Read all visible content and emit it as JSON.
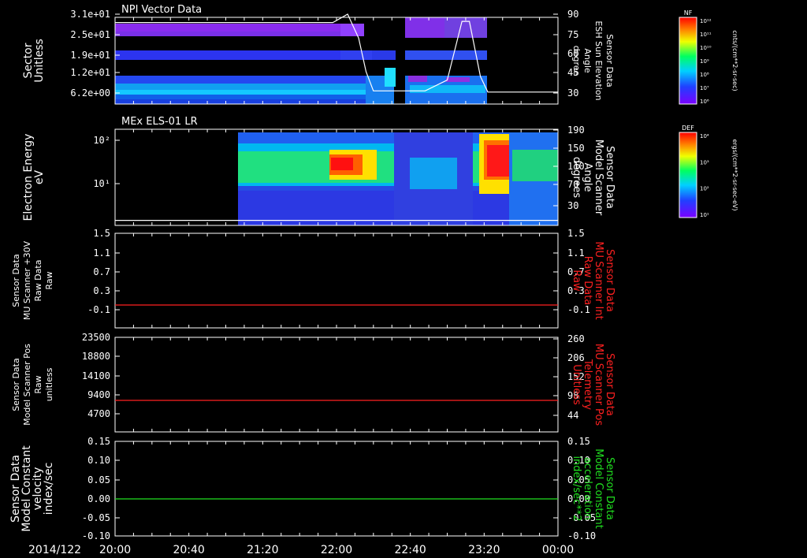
{
  "chart_data": {
    "type": "heatmap",
    "date_label": "2014/122",
    "x_axis": {
      "unit": "time",
      "start": "20:00",
      "end": "00:00",
      "ticks": [
        "20:00",
        "20:40",
        "21:20",
        "22:00",
        "22:40",
        "23:20",
        "00:00"
      ]
    },
    "panels": [
      {
        "id": "npi",
        "title": "NPI Vector Data",
        "type": "heatmap",
        "left_axis": {
          "label": [
            "Sector",
            "Unitless"
          ],
          "ticks": [
            "3.1e+01",
            "2.5e+01",
            "1.9e+01",
            "1.2e+01",
            "6.2e+00"
          ],
          "range": [
            0,
            31
          ]
        },
        "right_axis": {
          "label": [
            "Sensor Data",
            "ESH Sun Elevation",
            "Angle",
            "degree"
          ],
          "ticks": [
            "90",
            "75",
            "60",
            "45",
            "30"
          ],
          "range": [
            15,
            90
          ]
        },
        "colorbar": {
          "label": "NF",
          "unit": "cnts/(cm**2-sr-sec)",
          "ticks": [
            "10¹²",
            "10¹¹",
            "10¹⁰",
            "10⁹",
            "10⁸",
            "10⁷",
            "10⁶"
          ]
        },
        "overlay_series": {
          "name": "ESH Sun Elevation Angle",
          "color": "#ffffff",
          "x": [
            "20:00",
            "21:58",
            "22:06",
            "22:12",
            "22:16",
            "22:20",
            "22:30",
            "22:48",
            "23:00",
            "23:08",
            "23:12",
            "23:18",
            "23:22",
            "23:30",
            "00:00"
          ],
          "y": [
            83,
            83,
            90,
            70,
            42,
            26,
            26,
            26,
            35,
            84,
            84,
            38,
            25,
            25,
            25
          ]
        }
      },
      {
        "id": "els",
        "title": "MEx ELS-01 LR",
        "type": "heatmap",
        "left_axis": {
          "label": [
            "Electron Energy",
            "eV"
          ],
          "ticks": [
            "10²",
            "10¹"
          ],
          "scale": "log",
          "range": [
            1,
            200
          ]
        },
        "right_axis": {
          "label": [
            "Sensor Data",
            "Model Scanner",
            "Angle",
            "degrees"
          ],
          "ticks": [
            "190",
            "150",
            "110",
            "70",
            "30"
          ],
          "range": [
            0,
            190
          ]
        },
        "colorbar": {
          "label": "DEF",
          "unit": "ergs/(cm**2-sr-sec-eV)",
          "ticks": [
            "10⁴",
            "10³",
            "10²",
            "10¹"
          ]
        },
        "overlay_series": {
          "name": "Model Scanner Angle",
          "color": "#ffffff",
          "x": [
            "20:00",
            "00:00"
          ],
          "y": [
            10,
            10
          ]
        }
      },
      {
        "id": "mu30",
        "type": "line",
        "left_axis": {
          "label": [
            "Sensor Data",
            "MU Scanner +30V",
            "Raw Data",
            "Raw"
          ],
          "ticks": [
            "1.5",
            "1.1",
            "0.7",
            "0.3",
            "-0.1"
          ],
          "range": [
            -0.3,
            1.5
          ]
        },
        "right_axis": {
          "label": [
            "Sensor Data",
            "MU Scanner Int",
            "Raw Data",
            "Raw"
          ],
          "ticks": [
            "1.5",
            "1.1",
            "0.7",
            "0.3",
            "-0.1"
          ],
          "range": [
            -0.3,
            1.5
          ],
          "color": "#ff2020"
        },
        "series": [
          {
            "name": "MU Scanner Int",
            "color": "#ff2020",
            "x": [
              "20:00",
              "00:00"
            ],
            "y": [
              0.0,
              0.0
            ]
          }
        ]
      },
      {
        "id": "mupos",
        "type": "line",
        "left_axis": {
          "label": [
            "Sensor Data",
            "Model Scanner Pos",
            "Raw",
            "unitless"
          ],
          "ticks": [
            "23500",
            "18800",
            "14100",
            "9400",
            "4700"
          ],
          "range": [
            0,
            23500
          ]
        },
        "right_axis": {
          "label": [
            "Sensor Data",
            "MU Scanner Pos",
            "Telemetry",
            "Unitless"
          ],
          "ticks": [
            "260",
            "206",
            "152",
            "98",
            "44"
          ],
          "range": [
            0,
            260
          ],
          "color": "#ff2020"
        },
        "series": [
          {
            "name": "MU Scanner Pos Telemetry",
            "color": "#ff2020",
            "x": [
              "20:00",
              "00:00"
            ],
            "y": [
              82,
              82
            ]
          }
        ]
      },
      {
        "id": "const",
        "type": "line",
        "left_axis": {
          "label": [
            "Sensor Data",
            "Model Constant",
            "velocity",
            "index/sec"
          ],
          "ticks": [
            "0.15",
            "0.10",
            "0.05",
            "0.00",
            "-0.05",
            "-0.10"
          ],
          "range": [
            -0.1,
            0.15
          ]
        },
        "right_axis": {
          "label": [
            "Sensor Data",
            "Model Constant",
            "acceleration",
            "index/sec**2"
          ],
          "ticks": [
            "0.15",
            "0.10",
            "0.05",
            "0.00",
            "-0.05",
            "-0.10"
          ],
          "range": [
            -0.1,
            0.15
          ],
          "color": "#20e020"
        },
        "series": [
          {
            "name": "Model Constant acceleration",
            "color": "#20e020",
            "x": [
              "20:00",
              "00:00"
            ],
            "y": [
              0.0,
              0.0
            ]
          }
        ]
      }
    ]
  }
}
